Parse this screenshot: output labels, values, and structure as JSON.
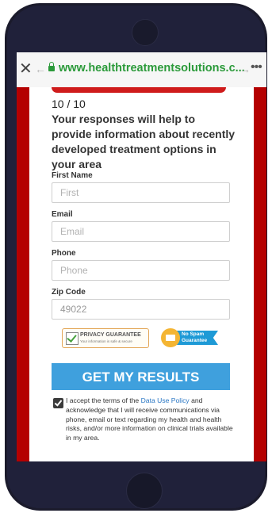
{
  "browser": {
    "url": "www.healthtreatmentsolutions.c...",
    "close_icon": "close-icon",
    "back_icon": "back-arrow-icon",
    "forward_icon": "forward-arrow-icon",
    "more_icon": "more-icon",
    "secure_icon": "lock-icon"
  },
  "progress": {
    "text": "10 / 10",
    "fraction": 1.0,
    "color": "#cf1b1b"
  },
  "heading": "Your responses will help to provide information about recently developed treatment options in your area",
  "form": {
    "first_name": {
      "label": "First Name",
      "placeholder": "First",
      "value": ""
    },
    "email": {
      "label": "Email",
      "placeholder": "Email",
      "value": ""
    },
    "phone": {
      "label": "Phone",
      "placeholder": "Phone",
      "value": ""
    },
    "zip": {
      "label": "Zip Code",
      "placeholder": "",
      "value": "49022"
    }
  },
  "badges": {
    "privacy_title": "PRIVACY GUARANTEE",
    "privacy_sub": "Your information is safe & secure",
    "no_spam_line1": "No Spam",
    "no_spam_line2": "Guarantee"
  },
  "cta_label": "GET MY RESULTS",
  "consent": {
    "checked": true,
    "before_link": "I accept the terms of the ",
    "link": "Data Use Policy",
    "after_link": " and acknowledge that I will receive communications via phone, email or text regarding my health and health risks, and/or more information on clinical trials available in my area."
  },
  "colors": {
    "accent_red": "#b40000",
    "cta_blue": "#3fa0dd",
    "url_green": "#2b9a3a",
    "phone_body": "#1b1b2c"
  }
}
